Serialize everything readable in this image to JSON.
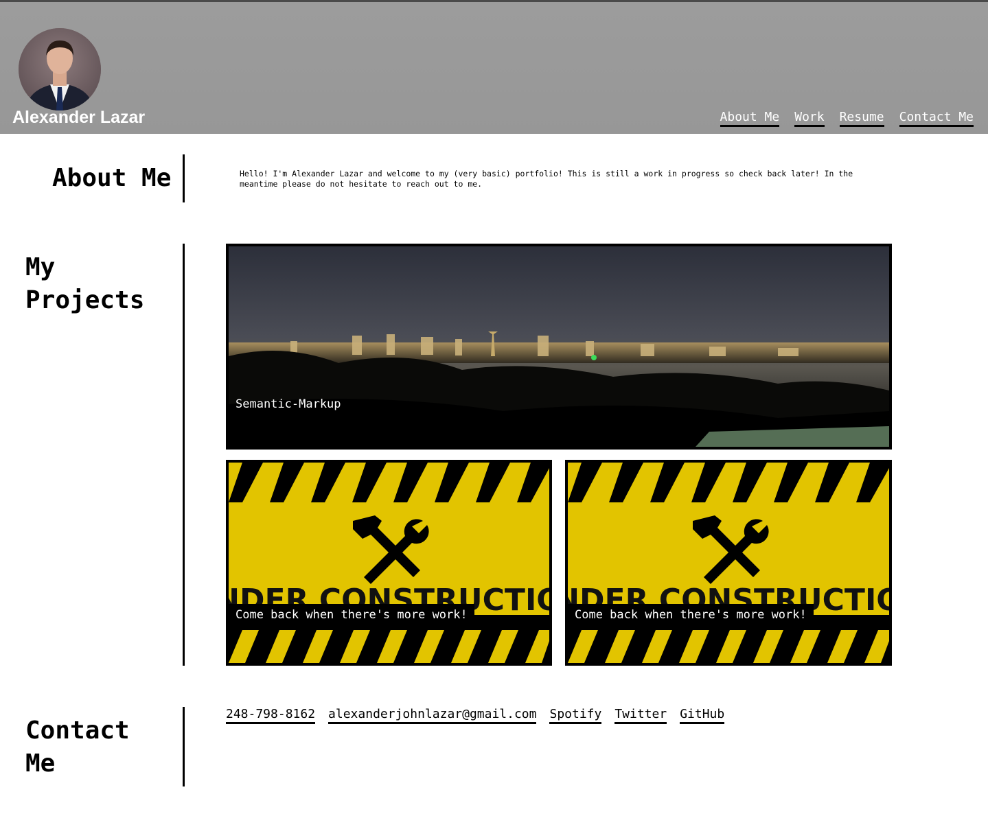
{
  "header": {
    "name": "Alexander Lazar",
    "nav": [
      {
        "label": "About Me"
      },
      {
        "label": "Work"
      },
      {
        "label": "Resume"
      },
      {
        "label": "Contact Me"
      }
    ]
  },
  "about": {
    "title": "About Me",
    "text": "Hello! I'm Alexander Lazar and welcome to my (very basic) portfolio! This is still a work in progress so check back later! In the meantime please do not hesitate to reach out to me."
  },
  "projects": {
    "title_line1": "My",
    "title_line2": "Projects",
    "items": [
      {
        "caption": "Semantic-Markup"
      },
      {
        "caption": "Come back when there's more work!",
        "banner": "UNDER CONSTRUCTION"
      },
      {
        "caption": "Come back when there's more work!",
        "banner": "UNDER CONSTRUCTION"
      }
    ]
  },
  "contact": {
    "title_line1": "Contact",
    "title_line2": "Me",
    "links": [
      {
        "label": "248-798-8162"
      },
      {
        "label": "alexanderjohnlazar@gmail.com"
      },
      {
        "label": "Spotify"
      },
      {
        "label": "Twitter"
      },
      {
        "label": "GitHub"
      }
    ]
  },
  "colors": {
    "header_bg": "#9b9b9b",
    "construction_yellow": "#e2c400",
    "text": "#000000"
  }
}
